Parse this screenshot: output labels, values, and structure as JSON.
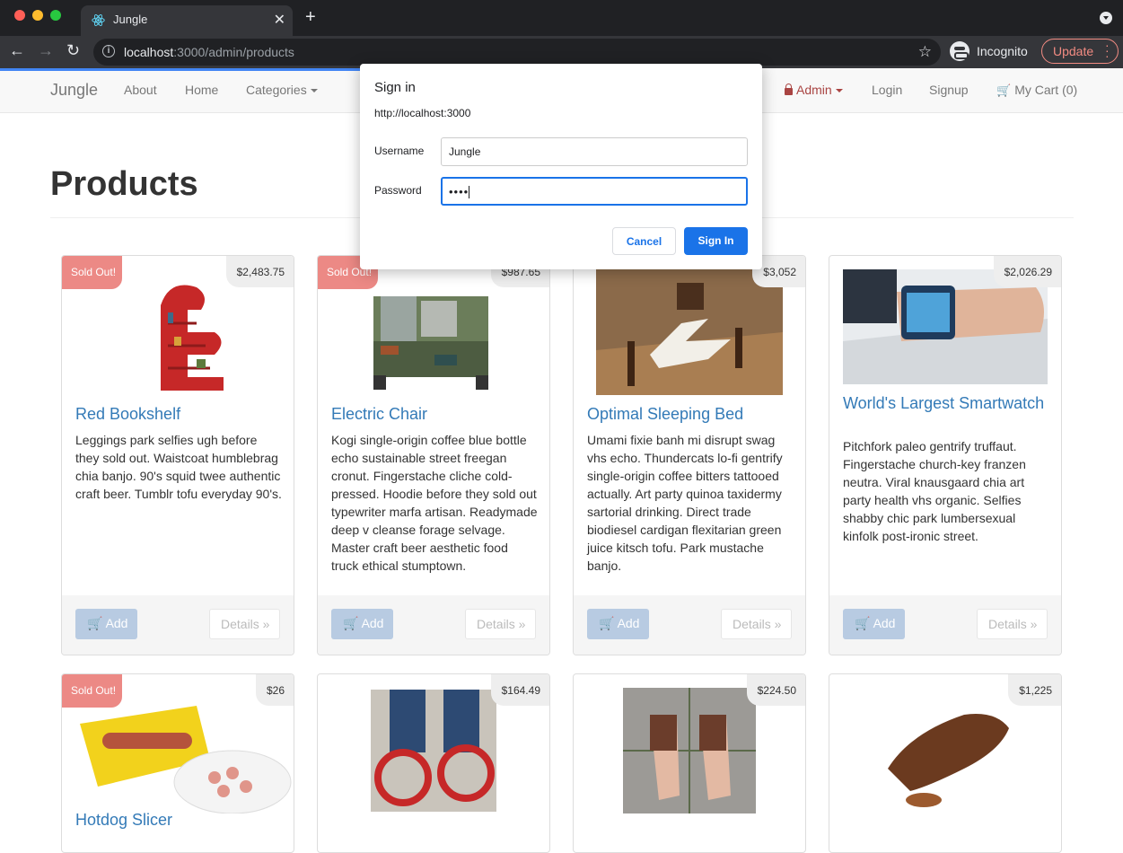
{
  "browser": {
    "tab_title": "Jungle",
    "new_tab": "+",
    "url_host": "localhost",
    "url_rest": ":3000/admin/products",
    "profile_label": "Incognito",
    "update_label": "Update"
  },
  "navbar": {
    "brand": "Jungle",
    "links": {
      "about": "About",
      "home": "Home",
      "categories": "Categories",
      "admin": "Admin",
      "login": "Login",
      "signup": "Signup",
      "cart": "My Cart (0)"
    }
  },
  "page": {
    "title": "Products"
  },
  "products": [
    {
      "name": "Red Bookshelf",
      "price": "$2,483.75",
      "sold_out": "Sold Out!",
      "description": "Leggings park selfies ugh before they sold out. Waistcoat humblebrag chia banjo. 90's squid twee authentic craft beer. Tumblr tofu everyday 90's.",
      "add": "Add",
      "details": "Details »"
    },
    {
      "name": "Electric Chair",
      "price": "$987.65",
      "sold_out": "Sold Out!",
      "description": "Kogi single-origin coffee blue bottle echo sustainable street freegan cronut. Fingerstache cliche cold-pressed. Hoodie before they sold out typewriter marfa artisan. Readymade deep v cleanse forage selvage. Master craft beer aesthetic food truck ethical stumptown.",
      "add": "Add",
      "details": "Details »"
    },
    {
      "name": "Optimal Sleeping Bed",
      "price": "$3,052",
      "description": "Umami fixie banh mi disrupt swag vhs echo. Thundercats lo-fi gentrify single-origin coffee bitters tattooed actually. Art party quinoa taxidermy sartorial drinking. Direct trade biodiesel cardigan flexitarian green juice kitsch tofu. Park mustache banjo.",
      "add": "Add",
      "details": "Details »"
    },
    {
      "name": "World's Largest Smartwatch",
      "price": "$2,026.29",
      "description": "Pitchfork paleo gentrify truffaut. Fingerstache church-key franzen neutra. Viral knausgaard chia art party health vhs organic. Selfies shabby chic park lumbersexual kinfolk post-ironic street.",
      "add": "Add",
      "details": "Details »"
    },
    {
      "name": "Hotdog Slicer",
      "price": "$26",
      "sold_out": "Sold Out!"
    },
    {
      "price": "$164.49"
    },
    {
      "price": "$224.50"
    },
    {
      "price": "$1,225"
    }
  ],
  "dialog": {
    "title": "Sign in",
    "origin": "http://localhost:3000",
    "username_label": "Username",
    "username_value": "Jungle",
    "password_label": "Password",
    "password_value": "••••",
    "cancel": "Cancel",
    "sign_in": "Sign In"
  }
}
